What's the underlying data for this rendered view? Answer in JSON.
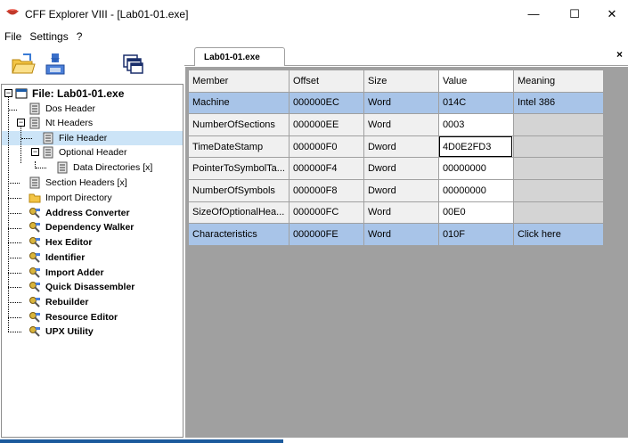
{
  "window": {
    "title": "CFF Explorer VIII - [Lab01-01.exe]",
    "minimize_glyph": "—",
    "maximize_glyph": "☐",
    "close_glyph": "✕"
  },
  "menu": {
    "items": [
      "File",
      "Settings",
      "?"
    ]
  },
  "toolbar": {
    "buttons": [
      "open-folder-icon",
      "save-disk-icon",
      "windows-icon"
    ]
  },
  "tab": {
    "label": "Lab01-01.exe",
    "close_glyph": "×"
  },
  "tree": {
    "root": "File: Lab01-01.exe",
    "items": [
      {
        "label": "Dos Header"
      },
      {
        "label": "Nt Headers"
      },
      {
        "label": "File Header"
      },
      {
        "label": "Optional Header"
      },
      {
        "label": "Data Directories [x]"
      },
      {
        "label": "Section Headers [x]"
      },
      {
        "label": "Import Directory"
      },
      {
        "label": "Address Converter"
      },
      {
        "label": "Dependency Walker"
      },
      {
        "label": "Hex Editor"
      },
      {
        "label": "Identifier"
      },
      {
        "label": "Import Adder"
      },
      {
        "label": "Quick Disassembler"
      },
      {
        "label": "Rebuilder"
      },
      {
        "label": "Resource Editor"
      },
      {
        "label": "UPX Utility"
      }
    ]
  },
  "grid": {
    "headers": [
      "Member",
      "Offset",
      "Size",
      "Value",
      "Meaning"
    ],
    "rows": [
      {
        "member": "Machine",
        "offset": "000000EC",
        "size": "Word",
        "value": "014C",
        "meaning": "Intel 386"
      },
      {
        "member": "NumberOfSections",
        "offset": "000000EE",
        "size": "Word",
        "value": "0003",
        "meaning": ""
      },
      {
        "member": "TimeDateStamp",
        "offset": "000000F0",
        "size": "Dword",
        "value": "4D0E2FD3",
        "meaning": ""
      },
      {
        "member": "PointerToSymbolTa...",
        "offset": "000000F4",
        "size": "Dword",
        "value": "00000000",
        "meaning": ""
      },
      {
        "member": "NumberOfSymbols",
        "offset": "000000F8",
        "size": "Dword",
        "value": "00000000",
        "meaning": ""
      },
      {
        "member": "SizeOfOptionalHea...",
        "offset": "000000FC",
        "size": "Word",
        "value": "00E0",
        "meaning": ""
      },
      {
        "member": "Characteristics",
        "offset": "000000FE",
        "size": "Word",
        "value": "010F",
        "meaning": "Click here"
      }
    ]
  },
  "colors": {
    "selection": "#cce4f7",
    "highlight_row": "#a8c4e8",
    "grid_background": "#a0a0a0",
    "status_accent": "#1c5a9c"
  }
}
